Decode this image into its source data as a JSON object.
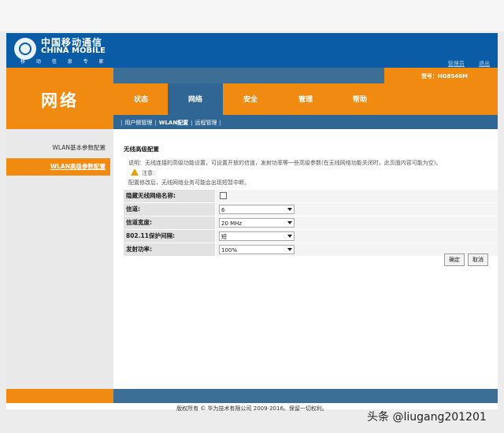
{
  "brand": {
    "logo_cn": "中国移动通信",
    "logo_en": "CHINA MOBILE",
    "slogan": "移 动 信 息 专 家"
  },
  "header": {
    "links": [
      "管理员",
      "退出"
    ],
    "model": "型号：HG8546M"
  },
  "section_title": "网络",
  "tabs": [
    "状态",
    "网络",
    "安全",
    "管理",
    "帮助"
  ],
  "active_tab": "网络",
  "subnav": {
    "items": [
      "用户侧管理",
      "WLAN配置",
      "远程管理"
    ],
    "active": "WLAN配置"
  },
  "sidebar": {
    "items": [
      {
        "label": "WLAN基本参数配置",
        "active": false
      },
      {
        "label": "WLAN高级参数配置",
        "active": true
      }
    ]
  },
  "content": {
    "title": "无线高级配置",
    "description": "说明：无线连接的高级功能设置，可设置开放的信道，发射功率等一些高级参数(在无线网络功能关闭时，此页面内容可能为空)。",
    "note": "注意:",
    "note_text": "配置修改后，无线网络业务可能会出现短暂中断。",
    "rows": [
      {
        "label": "隐藏无线网络名称:",
        "type": "checkbox",
        "checked": false
      },
      {
        "label": "信道:",
        "type": "select",
        "value": "6"
      },
      {
        "label": "信道宽度:",
        "type": "select",
        "value": "20 MHz"
      },
      {
        "label": "802.11保护间隔:",
        "type": "select",
        "value": "短"
      },
      {
        "label": "发射功率:",
        "type": "select",
        "value": "100%"
      }
    ],
    "confirm_label": "确定",
    "cancel_label": "取消"
  },
  "footer": {
    "copyright": "版权所有 © 华为技术有限公司 2009-2016。保留一切权利。"
  },
  "watermark": "头条 @liugang201201",
  "colors": {
    "brand_blue": "#0b5ca6",
    "orange": "#f08a10",
    "nav_blue": "#2f6693"
  }
}
